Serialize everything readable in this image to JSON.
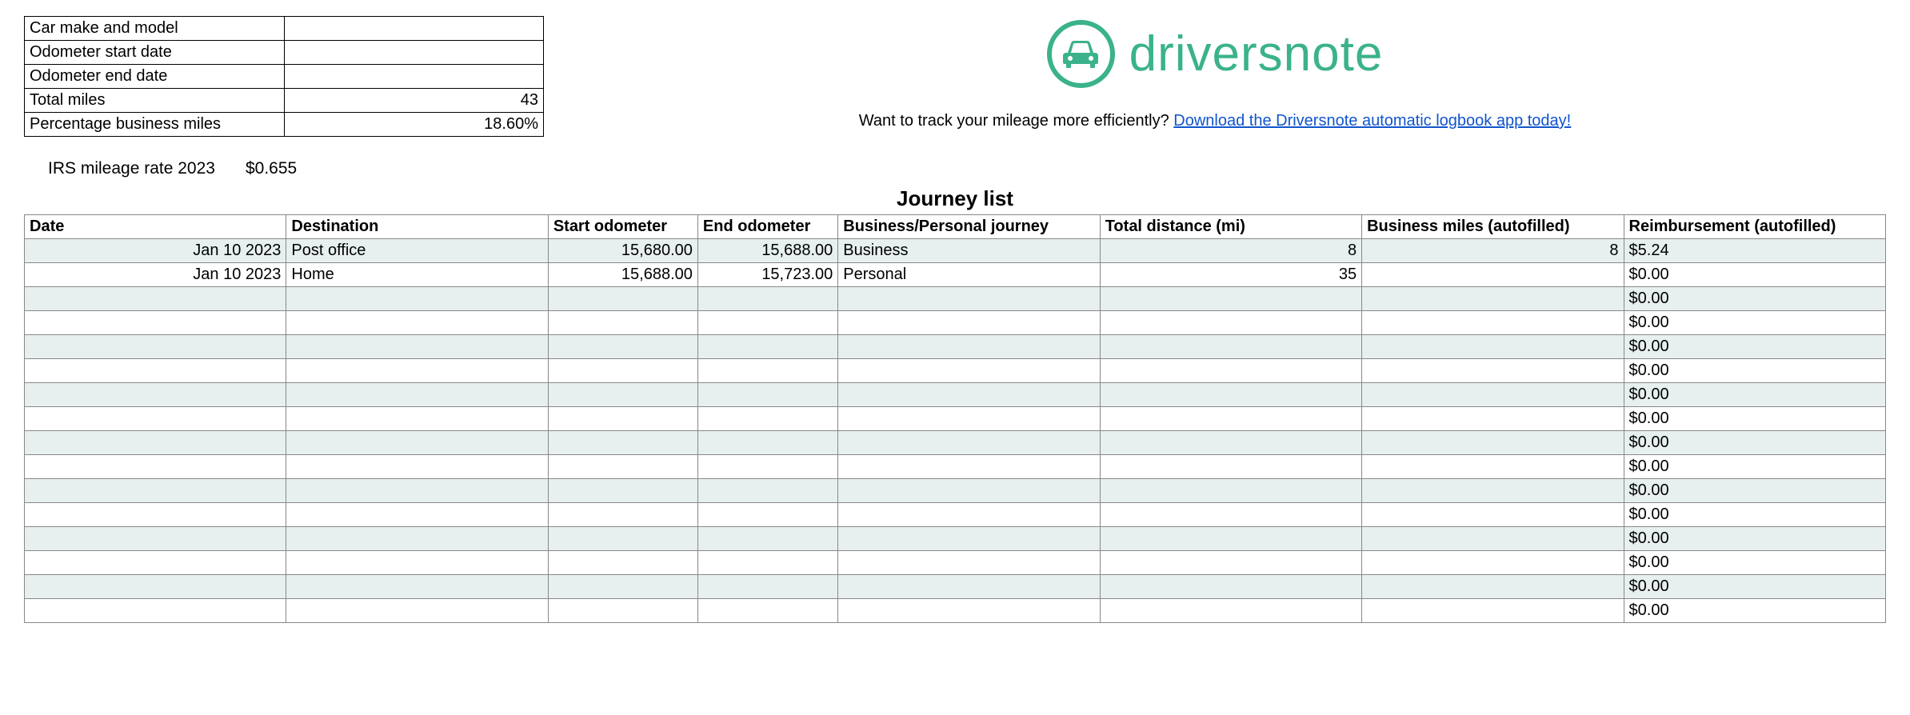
{
  "summary": {
    "rows": [
      {
        "label": "Car make and model",
        "value": ""
      },
      {
        "label": "Odometer start date",
        "value": ""
      },
      {
        "label": "Odometer end date",
        "value": ""
      },
      {
        "label": "Total miles",
        "value": "43"
      },
      {
        "label": "Percentage business miles",
        "value": "18.60%"
      }
    ]
  },
  "rate": {
    "label": "IRS mileage rate 2023",
    "value": "$0.655"
  },
  "logo": {
    "text": "driversnote"
  },
  "promo": {
    "prefix": "Want to track your mileage more efficiently? ",
    "link_text": "Download the Driversnote automatic logbook app today!"
  },
  "journey": {
    "title": "Journey list",
    "headers": [
      "Date",
      "Destination",
      "Start odometer",
      "End odometer",
      "Business/Personal journey",
      "Total distance (mi)",
      "Business miles (autofilled)",
      "Reimbursement (autofilled)"
    ],
    "rows": [
      {
        "date": "Jan 10 2023",
        "destination": "Post office",
        "start": "15,680.00",
        "end": "15,688.00",
        "type": "Business",
        "distance": "8",
        "bmiles": "8",
        "reimb": "$5.24"
      },
      {
        "date": "Jan 10 2023",
        "destination": "Home",
        "start": "15,688.00",
        "end": "15,723.00",
        "type": "Personal",
        "distance": "35",
        "bmiles": "",
        "reimb": "$0.00"
      },
      {
        "date": "",
        "destination": "",
        "start": "",
        "end": "",
        "type": "",
        "distance": "",
        "bmiles": "",
        "reimb": "$0.00"
      },
      {
        "date": "",
        "destination": "",
        "start": "",
        "end": "",
        "type": "",
        "distance": "",
        "bmiles": "",
        "reimb": "$0.00"
      },
      {
        "date": "",
        "destination": "",
        "start": "",
        "end": "",
        "type": "",
        "distance": "",
        "bmiles": "",
        "reimb": "$0.00"
      },
      {
        "date": "",
        "destination": "",
        "start": "",
        "end": "",
        "type": "",
        "distance": "",
        "bmiles": "",
        "reimb": "$0.00"
      },
      {
        "date": "",
        "destination": "",
        "start": "",
        "end": "",
        "type": "",
        "distance": "",
        "bmiles": "",
        "reimb": "$0.00"
      },
      {
        "date": "",
        "destination": "",
        "start": "",
        "end": "",
        "type": "",
        "distance": "",
        "bmiles": "",
        "reimb": "$0.00"
      },
      {
        "date": "",
        "destination": "",
        "start": "",
        "end": "",
        "type": "",
        "distance": "",
        "bmiles": "",
        "reimb": "$0.00"
      },
      {
        "date": "",
        "destination": "",
        "start": "",
        "end": "",
        "type": "",
        "distance": "",
        "bmiles": "",
        "reimb": "$0.00"
      },
      {
        "date": "",
        "destination": "",
        "start": "",
        "end": "",
        "type": "",
        "distance": "",
        "bmiles": "",
        "reimb": "$0.00"
      },
      {
        "date": "",
        "destination": "",
        "start": "",
        "end": "",
        "type": "",
        "distance": "",
        "bmiles": "",
        "reimb": "$0.00"
      },
      {
        "date": "",
        "destination": "",
        "start": "",
        "end": "",
        "type": "",
        "distance": "",
        "bmiles": "",
        "reimb": "$0.00"
      },
      {
        "date": "",
        "destination": "",
        "start": "",
        "end": "",
        "type": "",
        "distance": "",
        "bmiles": "",
        "reimb": "$0.00"
      },
      {
        "date": "",
        "destination": "",
        "start": "",
        "end": "",
        "type": "",
        "distance": "",
        "bmiles": "",
        "reimb": "$0.00"
      },
      {
        "date": "",
        "destination": "",
        "start": "",
        "end": "",
        "type": "",
        "distance": "",
        "bmiles": "",
        "reimb": "$0.00"
      }
    ]
  }
}
